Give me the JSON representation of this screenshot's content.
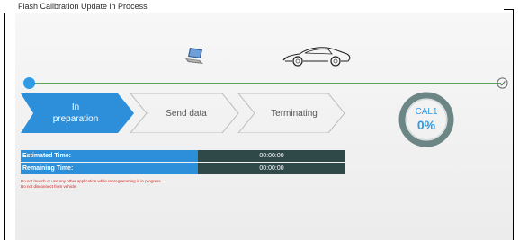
{
  "window": {
    "title": "Flash Calibration Update in Process"
  },
  "icons": {
    "laptop": "laptop-icon",
    "car": "car-icon",
    "check": "check-circle-icon"
  },
  "colors": {
    "accent": "#2e9be4",
    "active_step": "#2d8fd9",
    "track": "#5aa85a",
    "time_value_bg": "#2f4848",
    "warning": "#d22020"
  },
  "progress": {
    "fraction": 0
  },
  "steps": [
    {
      "label_line1": "In",
      "label_line2": "preparation",
      "state": "active"
    },
    {
      "label": "Send data",
      "state": "pending"
    },
    {
      "label": "Terminating",
      "state": "pending"
    }
  ],
  "calibration": {
    "name": "CAL1",
    "percent": "0%"
  },
  "times": {
    "estimated_label": "Estimated Time:",
    "estimated_value": "00:00:00",
    "remaining_label": "Remaining Time:",
    "remaining_value": "00:00:00"
  },
  "warnings": {
    "line1": "Do not launch or use any other application while reprogramming is in progress.",
    "line2": "Do not disconnect from vehicle."
  }
}
